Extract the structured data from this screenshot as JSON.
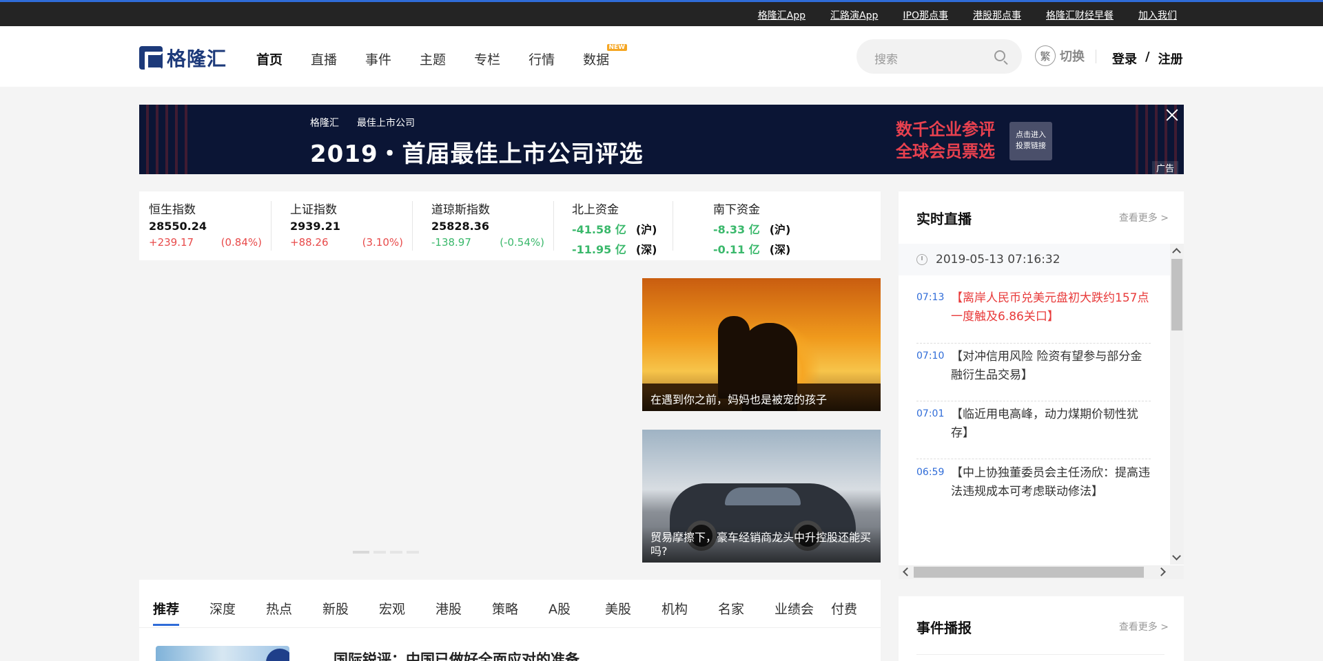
{
  "topbar": {
    "links": [
      "格隆汇App",
      "汇路演App",
      "IPO那点事",
      "港股那点事",
      "格隆汇财经早餐",
      "加入我们"
    ]
  },
  "header": {
    "logo_text": "格隆汇",
    "nav": [
      {
        "label": "首页",
        "active": true
      },
      {
        "label": "直播"
      },
      {
        "label": "事件"
      },
      {
        "label": "主题"
      },
      {
        "label": "专栏"
      },
      {
        "label": "行情"
      },
      {
        "label": "数据",
        "badge": "NEW"
      }
    ],
    "search_placeholder": "搜索",
    "trad_char": "繁",
    "switch_label": "切换",
    "login": "登录",
    "slash": "/",
    "register": "注册"
  },
  "banner": {
    "brand_left": "格隆汇",
    "brand_right": "最佳上市公司",
    "headline": "2019・首届最佳上市公司评选",
    "promo_line1": "数千企业参评",
    "promo_line2": "全球会员票选",
    "cta_line1": "点击进入",
    "cta_line2": "投票链接",
    "ad_label": "广告"
  },
  "indices": [
    {
      "name": "恒生指数",
      "value": "28550.24",
      "change": "+239.17",
      "pct": "(0.84%)",
      "direction": "up"
    },
    {
      "name": "上证指数",
      "value": "2939.21",
      "change": "+88.26",
      "pct": "(3.10%)",
      "direction": "up"
    },
    {
      "name": "道琼斯指数",
      "value": "25828.36",
      "change": "-138.97",
      "pct": "(-0.54%)",
      "direction": "down"
    }
  ],
  "flows": [
    {
      "name": "北上资金",
      "rows": [
        {
          "amount": "-41.58 亿",
          "market": "(沪)"
        },
        {
          "amount": "-11.95 亿",
          "market": "(深)"
        }
      ]
    },
    {
      "name": "南下资金",
      "rows": [
        {
          "amount": "-8.33 亿",
          "market": "(沪)"
        },
        {
          "amount": "-0.11 亿",
          "market": "(深)"
        }
      ]
    }
  ],
  "thumbs": [
    {
      "caption": "在遇到你之前，妈妈也是被宠的孩子"
    },
    {
      "caption": "贸易摩擦下，豪车经销商龙头中升控股还能买吗?"
    }
  ],
  "tabs": [
    "推荐",
    "深度",
    "热点",
    "新股",
    "宏观",
    "港股",
    "策略",
    "A股",
    "美股",
    "机构",
    "名家",
    "业绩会",
    "付费"
  ],
  "article": {
    "title": "国际锐评：中国已做好全面应对的准备"
  },
  "live": {
    "title": "实时直播",
    "more": "查看更多 >",
    "date": "2019-05-13 07:16:32",
    "items": [
      {
        "time": "07:13",
        "text": "【离岸人民币兑美元盘初大跌约157点 一度触及6.86关口】",
        "hot": true
      },
      {
        "time": "07:10",
        "text": "【对冲信用风险 险资有望参与部分金融衍生品交易】"
      },
      {
        "time": "07:01",
        "text": "【临近用电高峰，动力煤期价韧性犹存】"
      },
      {
        "time": "06:59",
        "text": "【中上协独董委员会主任汤欣：提高违法违规成本可考虑联动修法】"
      }
    ]
  },
  "events": {
    "title": "事件播报",
    "more": "查看更多 >"
  },
  "colors": {
    "accent": "#2f6cd8",
    "up": "#e84a4a",
    "down": "#3ab86b",
    "hot": "#e83a3a"
  }
}
